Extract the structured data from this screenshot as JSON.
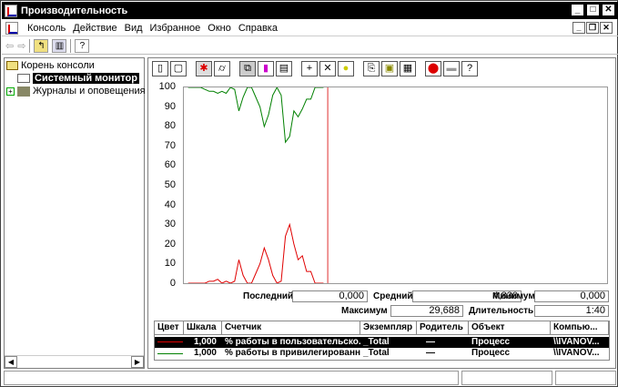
{
  "window": {
    "title": "Производительность"
  },
  "menu": [
    "Консоль",
    "Действие",
    "Вид",
    "Избранное",
    "Окно",
    "Справка"
  ],
  "tree": {
    "root": "Корень консоли",
    "items": [
      "Системный монитор",
      "Журналы и оповещения п"
    ]
  },
  "stats": {
    "last_label": "Последний",
    "last": "0,000",
    "avg_label": "Средний",
    "avg": "4,830",
    "min_label": "Минимум",
    "min": "0,000",
    "max_label": "Максимум",
    "max": "29,688",
    "dur_label": "Длительность",
    "dur": "1:40"
  },
  "legend": {
    "headers": [
      "Цвет",
      "Шкала",
      "Счетчик",
      "Экземпляр",
      "Родитель",
      "Объект",
      "Компью..."
    ],
    "rows": [
      {
        "color": "#e00000",
        "scale": "1,000",
        "counter": "% работы в пользовательско...",
        "instance": "_Total",
        "parent": "—",
        "object": "Процесс",
        "computer": "\\\\IVANOV..."
      },
      {
        "color": "#008000",
        "scale": "1,000",
        "counter": "% работы в привилегированн...",
        "instance": "_Total",
        "parent": "—",
        "object": "Процесс",
        "computer": "\\\\IVANOV..."
      }
    ]
  },
  "chart_data": {
    "type": "line",
    "ylim": [
      0,
      100
    ],
    "xlim": [
      0,
      100
    ],
    "yticks": [
      "100",
      "90",
      "80",
      "70",
      "60",
      "50",
      "40",
      "30",
      "20",
      "10",
      "0"
    ],
    "time_bar": 34,
    "series": [
      {
        "name": "% работы в пользовательском режиме",
        "color": "#e00000",
        "values": [
          0,
          0,
          0,
          0,
          0,
          1,
          1,
          2,
          0,
          1,
          0,
          1,
          12,
          4,
          0,
          0,
          5,
          10,
          18,
          12,
          4,
          0,
          1,
          24,
          30,
          20,
          12,
          14,
          6,
          6,
          0,
          0,
          0
        ]
      },
      {
        "name": "% работы в привилегированном режиме",
        "color": "#008000",
        "values": [
          100,
          100,
          100,
          100,
          99,
          98,
          98,
          97,
          98,
          97,
          100,
          99,
          88,
          95,
          100,
          100,
          95,
          90,
          80,
          86,
          96,
          100,
          96,
          72,
          75,
          88,
          85,
          89,
          94,
          94,
          100,
          100,
          100
        ]
      }
    ]
  }
}
